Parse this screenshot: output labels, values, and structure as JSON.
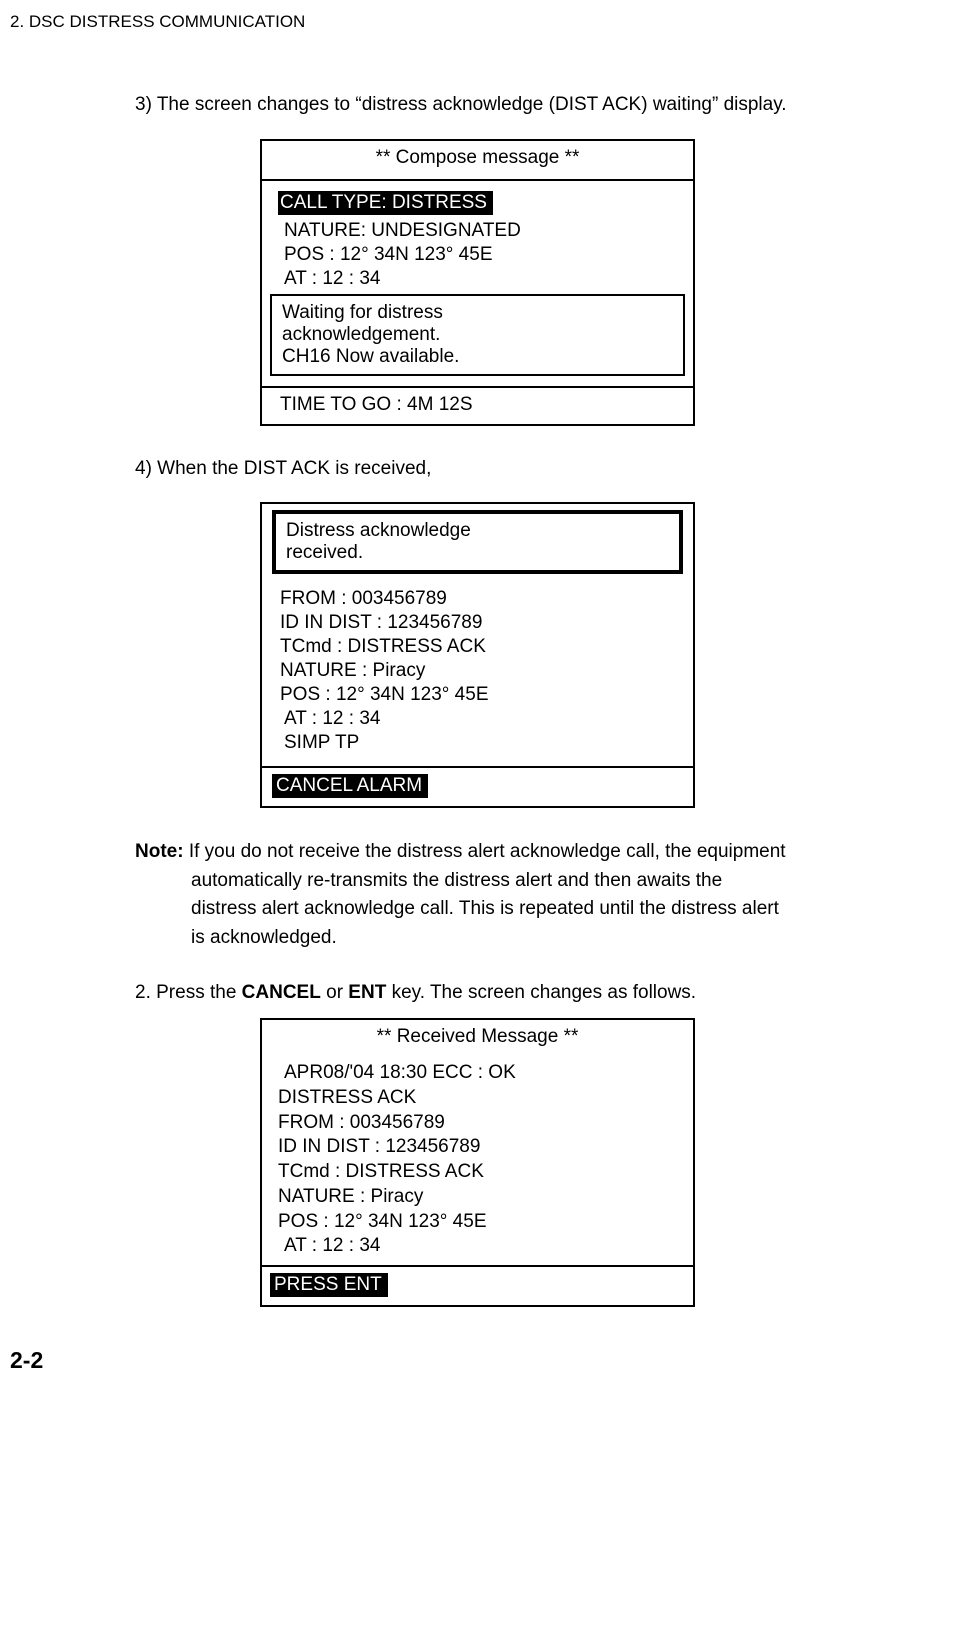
{
  "header": "2. DSC DISTRESS COMMUNICATION",
  "step3": "3) The screen changes to “distress acknowledge (DIST ACK) waiting” display.",
  "panel1": {
    "title": "** Compose message **",
    "call_type": "CALL TYPE: DISTRESS",
    "nature": "NATURE: UNDESIGNATED",
    "pos": "POS : 12° 34N  123° 45E",
    "at": "AT : 12 : 34",
    "wait1": "Waiting for distress",
    "wait2": "acknowledgement.",
    "wait3": "CH16 Now available.",
    "timetogo": "TIME TO GO : 4M  12S"
  },
  "step4": "4) When the DIST ACK is received,",
  "panel2": {
    "recv1": "Distress acknowledge",
    "recv2": "received.",
    "from": "FROM : 003456789",
    "idindist": "ID IN DIST : 123456789",
    "tcmd": "TCmd : DISTRESS ACK",
    "nature": "NATURE : Piracy",
    "pos": "POS : 12° 34N  123° 45E",
    "at": "AT : 12 : 34",
    "simp": "SIMP TP",
    "cancel": "CANCEL ALARM"
  },
  "note": {
    "label": "Note:",
    "line1": " If you do not receive the distress alert acknowledge call, the equipment",
    "line2": "automatically re-transmits the distress alert and then awaits the",
    "line3": "distress alert acknowledge call. This is repeated until the distress alert",
    "line4": "is acknowledged."
  },
  "step2line": {
    "pre": "2. Press the ",
    "b1": "CANCEL",
    "mid": " or ",
    "b2": "ENT",
    "post": " key. The screen changes as follows."
  },
  "panel3": {
    "title": "** Received Message **",
    "line1": "APR08/'04 18:30    ECC : OK",
    "line2": "DISTRESS ACK",
    "line3": "FROM : 003456789",
    "line4": "ID IN DIST : 123456789",
    "line5": "TCmd : DISTRESS ACK",
    "line6": "NATURE : Piracy",
    "line7": "POS : 12° 34N  123° 45E",
    "line8": "AT : 12 : 34",
    "press": "PRESS ENT"
  },
  "pagenum": "2-2"
}
